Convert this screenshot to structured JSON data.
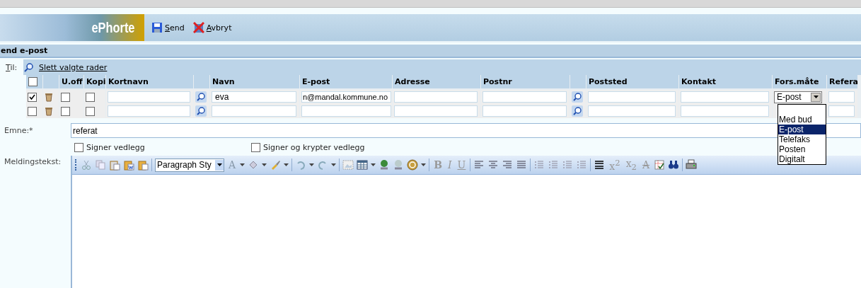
{
  "header": {
    "logo": "ePhorte",
    "actions": [
      {
        "kind": "save",
        "label": "Send"
      },
      {
        "kind": "cancel",
        "label": "Avbryt"
      }
    ]
  },
  "section_title": "end e-post",
  "recipients": {
    "label": "Til:",
    "all_checked": false,
    "delete_link": "Slett valgte rader",
    "columns": {
      "u_off": "U.off",
      "kopi": "Kopi",
      "kortnavn": "Kortnavn",
      "navn": "Navn",
      "epost": "E-post",
      "adresse": "Adresse",
      "postnr": "Postnr",
      "poststed": "Poststed",
      "kontakt": "Kontakt",
      "fors_mate": "Fors.måte",
      "column_15": "Refera"
    },
    "rows": [
      {
        "checked": true,
        "u_off": false,
        "kopi": false,
        "navn": "eva",
        "epost": "n@mandal.kommune.no",
        "fors_mate": "E-post"
      },
      {
        "checked": false,
        "u_off": false,
        "kopi": false
      }
    ],
    "dropdown": [
      {
        "kind": "option",
        "label": "Med bud",
        "selected": false
      },
      {
        "kind": "option",
        "label": "E-post",
        "selected": true
      },
      {
        "kind": "option",
        "label": "Telefaks",
        "selected": false
      },
      {
        "kind": "option",
        "label": "Posten",
        "selected": false
      },
      {
        "kind": "option",
        "label": "Digitalt",
        "selected": false
      }
    ]
  },
  "subject": {
    "label": "Emne:*",
    "value": "referat"
  },
  "options": [
    {
      "label": "Signer vedlegg",
      "checked": false
    },
    {
      "label": "Signer og krypter vedlegg",
      "checked": false
    }
  ],
  "message": {
    "label": "Meldingstekst:",
    "style_select": "Paragraph Sty",
    "glyphs": [
      "A",
      "B",
      "I",
      "U",
      "x$^{2}$",
      "x$_{2}$",
      "A"
    ]
  }
}
